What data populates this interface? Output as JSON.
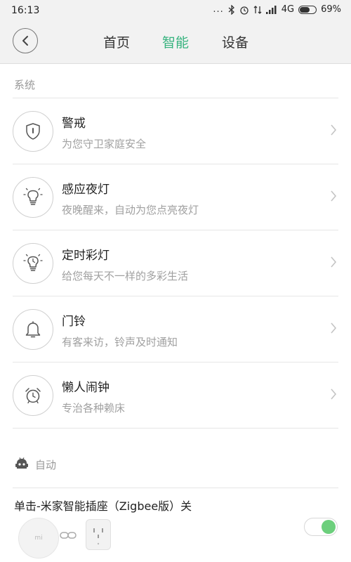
{
  "status_bar": {
    "time": "16:13",
    "dots": "...",
    "network": "4G",
    "battery_percent_text": "69%",
    "battery_level": 0.69
  },
  "header": {
    "tabs": [
      {
        "label": "首页",
        "active": false
      },
      {
        "label": "智能",
        "active": true
      },
      {
        "label": "设备",
        "active": false
      }
    ],
    "accent_color": "#36b37e"
  },
  "system_section": {
    "title": "系统",
    "items": [
      {
        "title": "警戒",
        "subtitle": "为您守卫家庭安全",
        "icon": "shield-icon"
      },
      {
        "title": "感应夜灯",
        "subtitle": "夜晚醒来，自动为您点亮夜灯",
        "icon": "bulb-icon"
      },
      {
        "title": "定时彩灯",
        "subtitle": "给您每天不一样的多彩生活",
        "icon": "timer-bulb-icon"
      },
      {
        "title": "门铃",
        "subtitle": "有客来访，铃声及时通知",
        "icon": "bell-icon"
      },
      {
        "title": "懒人闹钟",
        "subtitle": "专治各种赖床",
        "icon": "alarm-clock-icon"
      }
    ]
  },
  "auto_section": {
    "title": "自动",
    "rule_title": "单击-米家智能插座（Zigbee版）关",
    "button_device_text": "mi",
    "toggle_on": true,
    "toggle_color": "#6ccf7c"
  }
}
